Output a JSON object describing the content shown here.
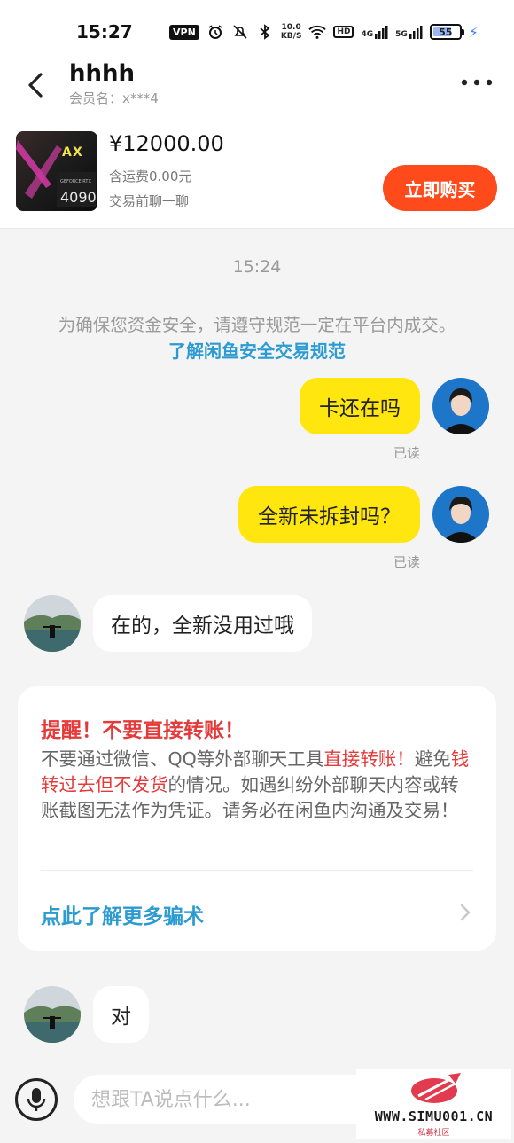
{
  "status_bar": {
    "time": "15:27",
    "vpn": "VPN",
    "speed_value": "10.0",
    "speed_unit": "KB/S",
    "hd": "HD",
    "net1": "4G",
    "net2": "5G",
    "battery": "55"
  },
  "header": {
    "title": "hhhh",
    "subtitle": "会员名：x***4"
  },
  "product": {
    "price": "¥12000.00",
    "shipping": "含运费0.00元",
    "chat_first": "交易前聊一聊",
    "buy_label": "立即购买",
    "thumb_text_1": "GEFORCE RTX",
    "thumb_text_2": "4090"
  },
  "chat": {
    "timestamp": "15:24",
    "notice": "为确保您资金安全，请遵守规范一定在平台内成交。",
    "notice_link": "了解闲鱼安全交易规范",
    "messages": [
      {
        "from": "me",
        "text": "卡还在吗",
        "status": "已读"
      },
      {
        "from": "me",
        "text": "全新未拆封吗？",
        "status": "已读"
      },
      {
        "from": "other",
        "text": "在的，全新没用过哦"
      },
      {
        "from": "other",
        "text": "对"
      }
    ]
  },
  "warning": {
    "title": "提醒！不要直接转账！",
    "body_1": "不要通过微信、QQ等外部聊天工具",
    "body_red_1": "直接转账！",
    "body_2": "避免",
    "body_red_2": "钱转过去但不发货",
    "body_3": "的情况。如遇纠纷外部聊天内容或转账截图无法作为凭证。请务必在闲鱼内沟通及交易！",
    "link": "点此了解更多骗术"
  },
  "input": {
    "placeholder": "想跟TA说点什么..."
  },
  "watermark": {
    "text": "WWW.SIMU001.CN",
    "sub": "私募社区"
  },
  "colors": {
    "accent_orange": "#ff4a1c",
    "bubble_yellow": "#ffe60f",
    "link_blue": "#2b9bd2",
    "warn_red": "#e5393a"
  }
}
